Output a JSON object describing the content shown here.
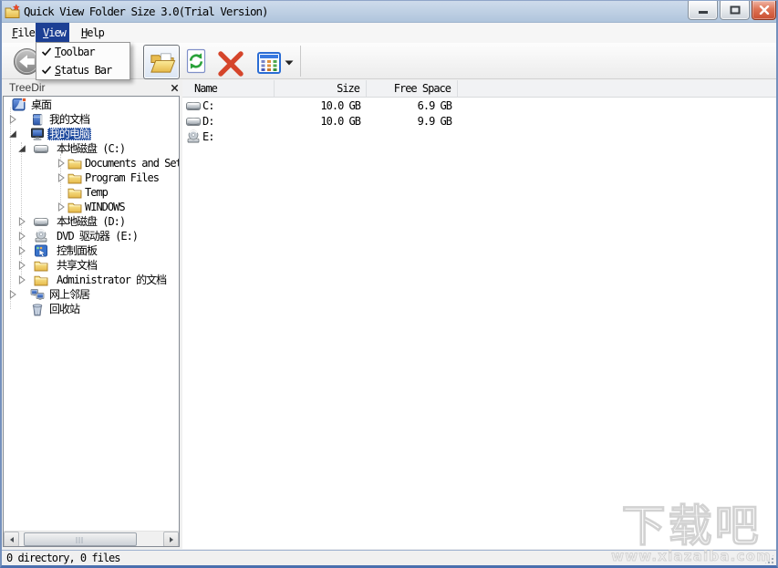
{
  "window": {
    "title": "Quick View Folder Size 3.0(Trial Version)",
    "controls": [
      {
        "name": "minimize"
      },
      {
        "name": "maximize"
      },
      {
        "name": "close"
      }
    ]
  },
  "menu_bar": {
    "items": [
      {
        "label": "File",
        "active": false
      },
      {
        "label": "View",
        "active": true
      },
      {
        "label": "Help",
        "active": false
      }
    ]
  },
  "view_menu": {
    "items": [
      {
        "label": "Toolbar",
        "checked": true
      },
      {
        "label": "Status Bar",
        "checked": true
      }
    ]
  },
  "toolbar": {
    "buttons": [
      {
        "icon": "back-arrow-icon",
        "pressed": false
      },
      {
        "icon": "open-folder-icon",
        "pressed": true
      },
      {
        "icon": "refresh-icon",
        "pressed": false
      },
      {
        "icon": "delete-icon",
        "pressed": false
      },
      {
        "icon": "views-grid-icon",
        "pressed": false
      },
      {
        "icon": "views-dropdown-caret-icon",
        "pressed": false
      }
    ]
  },
  "left_panel": {
    "caption": "TreeDir"
  },
  "tree": {
    "items": [
      {
        "label": "桌面",
        "level": 0,
        "arrow": null,
        "icon": "desktop",
        "selected": false
      },
      {
        "label": "我的文档",
        "level": 1,
        "arrow": "collapsed",
        "icon": "documents",
        "selected": false
      },
      {
        "label": "我的电脑",
        "level": 1,
        "arrow": "expanded",
        "icon": "computer",
        "selected": true
      },
      {
        "label": "本地磁盘 (C:)",
        "level": 2,
        "arrow": "expanded",
        "icon": "drive",
        "selected": false
      },
      {
        "label": "Documents and Settings",
        "level": 3,
        "arrow": "collapsed",
        "icon": "folder",
        "selected": false
      },
      {
        "label": "Program Files",
        "level": 3,
        "arrow": "collapsed",
        "icon": "folder",
        "selected": false
      },
      {
        "label": "Temp",
        "level": 3,
        "arrow": null,
        "icon": "folder",
        "selected": false
      },
      {
        "label": "WINDOWS",
        "level": 3,
        "arrow": "collapsed",
        "icon": "folder",
        "selected": false
      },
      {
        "label": "本地磁盘 (D:)",
        "level": 2,
        "arrow": "collapsed",
        "icon": "drive",
        "selected": false
      },
      {
        "label": "DVD 驱动器 (E:)",
        "level": 2,
        "arrow": "collapsed",
        "icon": "cd-drive",
        "selected": false
      },
      {
        "label": "控制面板",
        "level": 2,
        "arrow": "collapsed",
        "icon": "control-panel",
        "selected": false
      },
      {
        "label": "共享文档",
        "level": 2,
        "arrow": "collapsed",
        "icon": "folder",
        "selected": false
      },
      {
        "label": "Administrator 的文档",
        "level": 2,
        "arrow": "collapsed",
        "icon": "folder",
        "selected": false
      },
      {
        "label": "网上邻居",
        "level": 1,
        "arrow": "collapsed",
        "icon": "network",
        "selected": false
      },
      {
        "label": "回收站",
        "level": 1,
        "arrow": null,
        "icon": "recycle-bin",
        "selected": false
      }
    ]
  },
  "list": {
    "columns": [
      {
        "label": "Name"
      },
      {
        "label": "Size"
      },
      {
        "label": "Free Space"
      }
    ],
    "rows": [
      {
        "name": "C:",
        "size": "10.0 GB",
        "free_space": "6.9 GB",
        "icon": "drive"
      },
      {
        "name": "D:",
        "size": "10.0 GB",
        "free_space": "9.9 GB",
        "icon": "drive"
      },
      {
        "name": "E:",
        "size": "",
        "free_space": "",
        "icon": "cd-drive"
      }
    ]
  },
  "status_bar": {
    "text": "0 directory, 0 files"
  },
  "watermark": {
    "title": "下载吧",
    "url": "www.xiazaiba.com"
  },
  "colors": {
    "selection": "#1e4a9e",
    "menu_highlight": "#1c3f94",
    "close_button": "#c94f31",
    "titlebar": "#b0c5dc"
  }
}
